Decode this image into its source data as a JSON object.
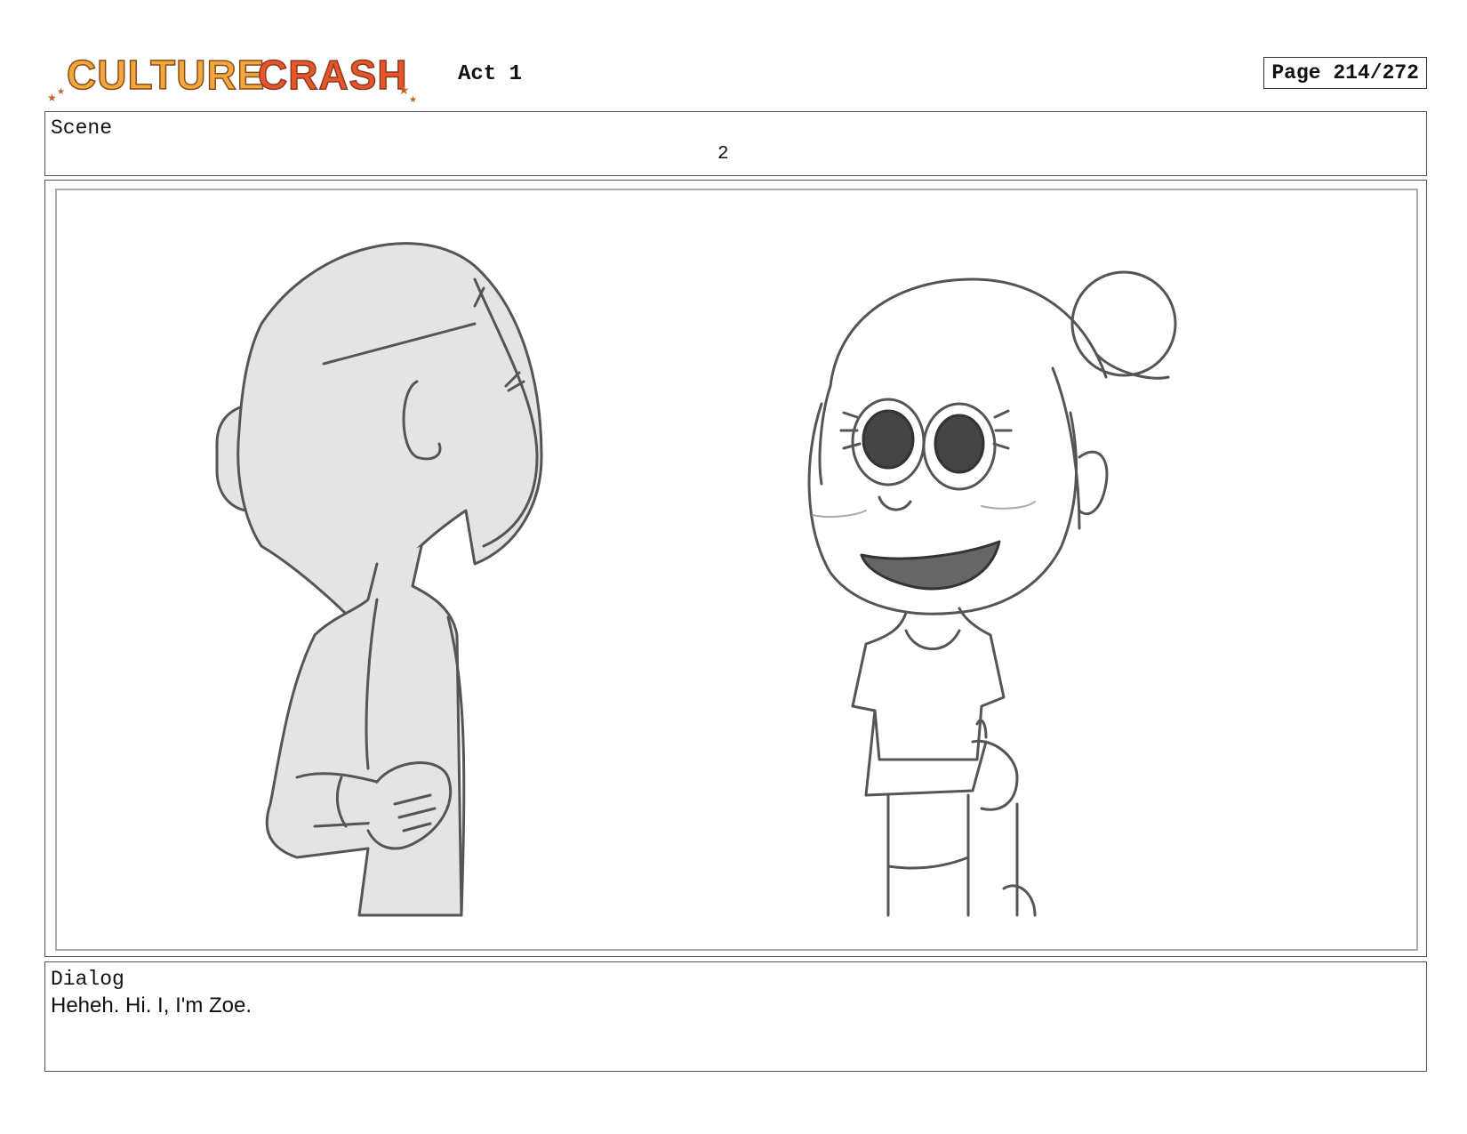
{
  "header": {
    "logo_text": "CULTURE CRASH",
    "act": "Act 1",
    "page": "Page 214/272"
  },
  "scene": {
    "label": "Scene",
    "value": "2"
  },
  "panel": {
    "description_icon": "storyboard-sketch"
  },
  "dialog": {
    "label": "Dialog",
    "text": "Heheh. Hi. I, I'm Zoe."
  },
  "colors": {
    "logo_yellow": "#F2A93B",
    "logo_orange": "#E8552B",
    "logo_outline": "#8A4A1C",
    "sketch_line": "#555555",
    "sketch_fill": "#E4E4E4"
  }
}
